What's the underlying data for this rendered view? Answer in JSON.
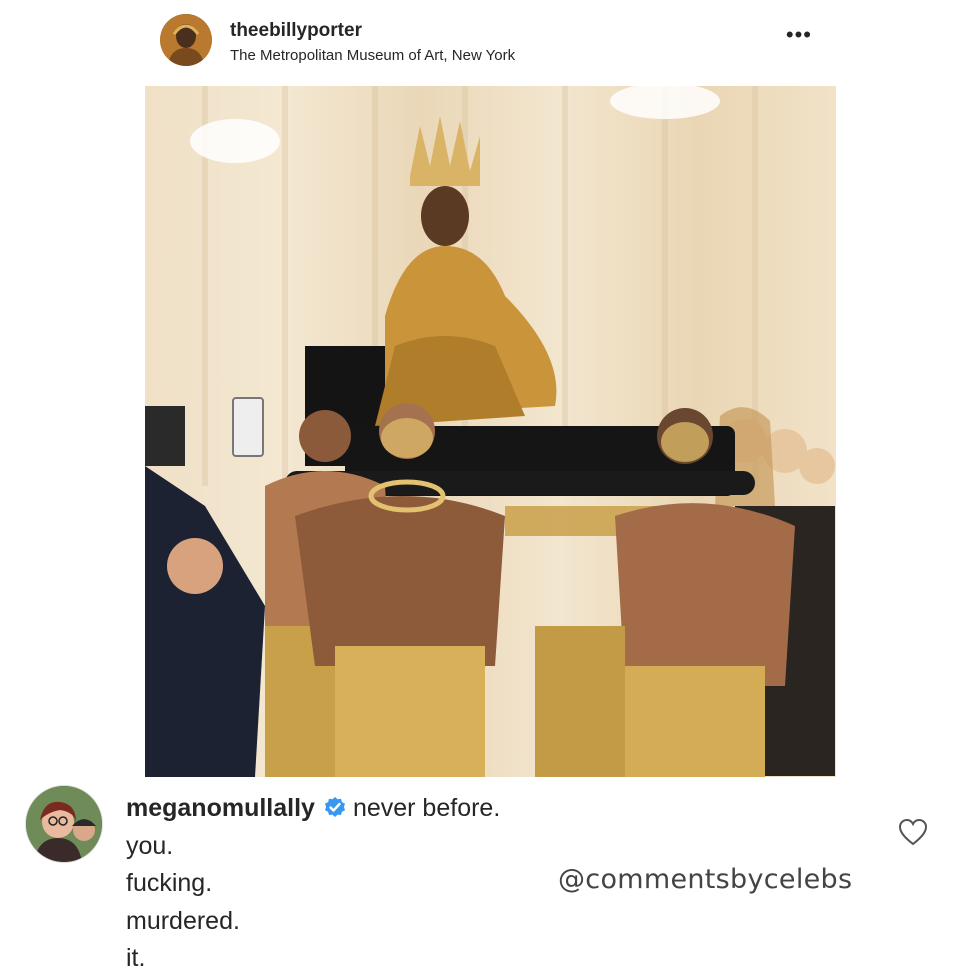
{
  "post": {
    "username": "theebillyporter",
    "location": "The Metropolitan Museum of Art, New York",
    "more_icon": "ellipsis-icon"
  },
  "comment": {
    "username": "meganomullally",
    "verified_icon": "verified-badge-icon",
    "lines": [
      "never before.",
      "you.",
      "fucking.",
      "murdered.",
      "it."
    ],
    "like_icon": "heart-outline-icon"
  },
  "watermark": "@commentsbycelebs",
  "colors": {
    "verified": "#3897f0",
    "gold": "#c9a04a"
  }
}
